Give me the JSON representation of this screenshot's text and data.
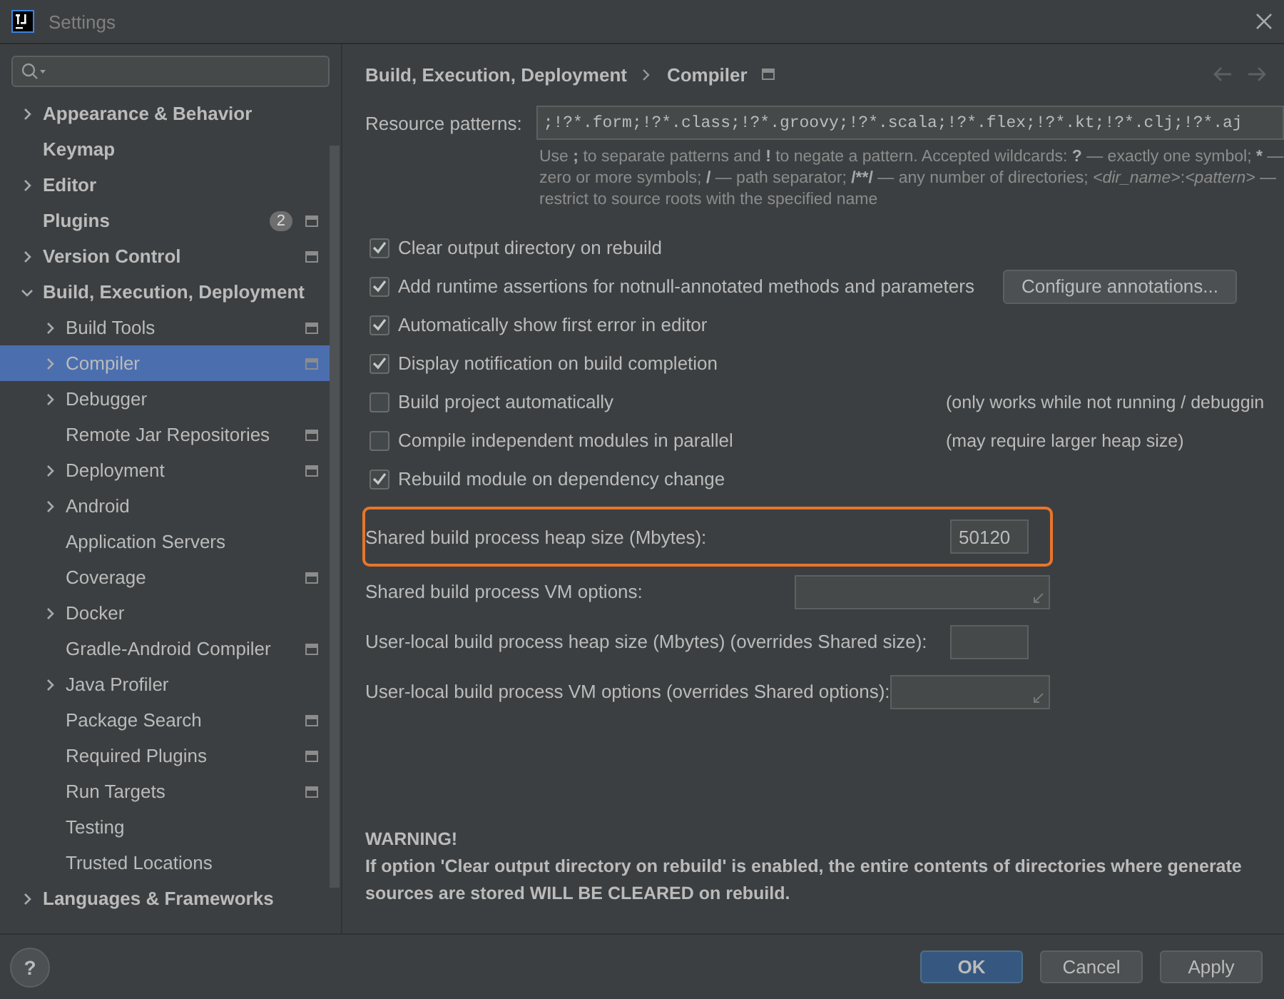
{
  "window": {
    "title": "Settings"
  },
  "tree": [
    {
      "label": "Appearance & Behavior",
      "expandable": true,
      "expanded": false,
      "selected": false,
      "project_icon": false
    },
    {
      "label": "Keymap",
      "expandable": false,
      "selected": false,
      "project_icon": false
    },
    {
      "label": "Editor",
      "expandable": true,
      "expanded": false,
      "selected": false,
      "project_icon": false
    },
    {
      "label": "Plugins",
      "expandable": false,
      "selected": false,
      "project_icon": true,
      "badge": "2"
    },
    {
      "label": "Version Control",
      "expandable": true,
      "expanded": false,
      "selected": false,
      "project_icon": true
    },
    {
      "label": "Build, Execution, Deployment",
      "expandable": true,
      "expanded": true,
      "selected": false,
      "project_icon": false,
      "children": [
        {
          "label": "Build Tools",
          "expandable": true,
          "expanded": false,
          "selected": false,
          "project_icon": true
        },
        {
          "label": "Compiler",
          "expandable": true,
          "expanded": false,
          "selected": true,
          "project_icon": true
        },
        {
          "label": "Debugger",
          "expandable": true,
          "expanded": false,
          "selected": false,
          "project_icon": false
        },
        {
          "label": "Remote Jar Repositories",
          "expandable": false,
          "selected": false,
          "project_icon": true
        },
        {
          "label": "Deployment",
          "expandable": true,
          "expanded": false,
          "selected": false,
          "project_icon": true
        },
        {
          "label": "Android",
          "expandable": true,
          "expanded": false,
          "selected": false,
          "project_icon": false
        },
        {
          "label": "Application Servers",
          "expandable": false,
          "selected": false,
          "project_icon": false
        },
        {
          "label": "Coverage",
          "expandable": false,
          "selected": false,
          "project_icon": true
        },
        {
          "label": "Docker",
          "expandable": true,
          "expanded": false,
          "selected": false,
          "project_icon": false
        },
        {
          "label": "Gradle-Android Compiler",
          "expandable": false,
          "selected": false,
          "project_icon": true
        },
        {
          "label": "Java Profiler",
          "expandable": true,
          "expanded": false,
          "selected": false,
          "project_icon": false
        },
        {
          "label": "Package Search",
          "expandable": false,
          "selected": false,
          "project_icon": true
        },
        {
          "label": "Required Plugins",
          "expandable": false,
          "selected": false,
          "project_icon": true
        },
        {
          "label": "Run Targets",
          "expandable": false,
          "selected": false,
          "project_icon": true
        },
        {
          "label": "Testing",
          "expandable": false,
          "selected": false,
          "project_icon": false
        },
        {
          "label": "Trusted Locations",
          "expandable": false,
          "selected": false,
          "project_icon": false
        }
      ]
    },
    {
      "label": "Languages & Frameworks",
      "expandable": true,
      "expanded": false,
      "selected": false,
      "project_icon": false
    }
  ],
  "breadcrumb": [
    "Build, Execution, Deployment",
    "Compiler"
  ],
  "resource_patterns": {
    "label": "Resource patterns:",
    "value": ";!?*.form;!?*.class;!?*.groovy;!?*.scala;!?*.flex;!?*.kt;!?*.clj;!?*.aj",
    "hint": [
      {
        "text": "Use ",
        "kind": "plain"
      },
      {
        "text": ";",
        "kind": "bold"
      },
      {
        "text": " to separate patterns and ",
        "kind": "plain"
      },
      {
        "text": "!",
        "kind": "bold"
      },
      {
        "text": " to negate a pattern. Accepted wildcards: ",
        "kind": "plain"
      },
      {
        "text": "?",
        "kind": "bold"
      },
      {
        "text": " — exactly one symbol; ",
        "kind": "plain"
      },
      {
        "text": "*",
        "kind": "bold"
      },
      {
        "text": " — zero or more symbols; ",
        "kind": "plain"
      },
      {
        "text": "/",
        "kind": "bold"
      },
      {
        "text": " — path separator; ",
        "kind": "plain"
      },
      {
        "text": "/**/",
        "kind": "bold"
      },
      {
        "text": " — any number of directories; ",
        "kind": "plain"
      },
      {
        "text": "<dir_name>",
        "kind": "italic"
      },
      {
        "text": ":",
        "kind": "plain"
      },
      {
        "text": "<pattern>",
        "kind": "italic"
      },
      {
        "text": " — restrict to source roots with the specified name",
        "kind": "plain"
      }
    ]
  },
  "options": [
    {
      "label": "Clear output directory on rebuild",
      "checked": true
    },
    {
      "label": "Add runtime assertions for notnull-annotated methods and parameters",
      "checked": true,
      "button": "Configure annotations..."
    },
    {
      "label": "Automatically show first error in editor",
      "checked": true
    },
    {
      "label": "Display notification on build completion",
      "checked": true
    },
    {
      "label": "Build project automatically",
      "checked": false,
      "note": "(only works while not running / debuggin"
    },
    {
      "label": "Compile independent modules in parallel",
      "checked": false,
      "note": "(may require larger heap size)"
    },
    {
      "label": "Rebuild module on dependency change",
      "checked": true
    }
  ],
  "fields": [
    {
      "label": "Shared build process heap size (Mbytes):",
      "value": "50120",
      "kind": "short",
      "highlighted": true
    },
    {
      "label": "Shared build process VM options:",
      "kind": "wide",
      "highlighted": false
    },
    {
      "label": "User-local build process heap size (Mbytes) (overrides Shared size):",
      "kind": "short",
      "highlighted": false
    },
    {
      "label": "User-local build process VM options (overrides Shared options):",
      "kind": "wide",
      "highlighted": false
    }
  ],
  "warning": {
    "title": "WARNING!",
    "text": "If option 'Clear output directory on rebuild' is enabled, the entire contents of directories where generate sources are stored WILL BE CLEARED on rebuild."
  },
  "help": "?",
  "buttons": [
    {
      "label": "OK",
      "primary": true
    },
    {
      "label": "Cancel",
      "primary": false
    },
    {
      "label": "Apply",
      "primary": false
    }
  ]
}
